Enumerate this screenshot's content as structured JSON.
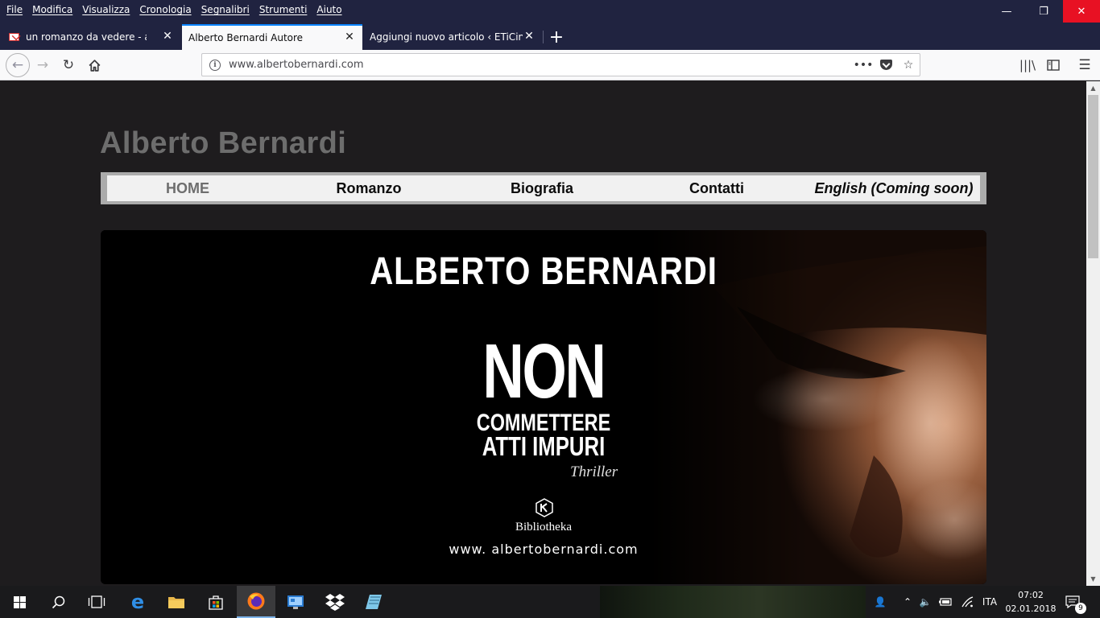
{
  "menu": {
    "items": [
      "File",
      "Modifica",
      "Visualizza",
      "Cronologia",
      "Segnalibri",
      "Strumenti",
      "Aiuto"
    ]
  },
  "window_controls": {
    "minimize": "—",
    "maximize": "❐",
    "close": "✕"
  },
  "tabs": [
    {
      "title": "un romanzo da vedere - associa",
      "icon": "gmail-icon",
      "active": false
    },
    {
      "title": "Alberto Bernardi Autore",
      "icon": "none",
      "active": true
    },
    {
      "title": "Aggiungi nuovo articolo ‹ ETiCinfo",
      "icon": "none",
      "active": false
    }
  ],
  "urlbar": {
    "url": "www.albertobernardi.com"
  },
  "site": {
    "title": "Alberto Bernardi",
    "nav": [
      "HOME",
      "Romanzo",
      "Biografia",
      "Contatti",
      "English (Coming soon)"
    ],
    "active_nav": "HOME",
    "banner": {
      "author": "ALBERTO BERNARDI",
      "title_big": "NON",
      "title_line1": "COMMETTERE",
      "title_line2": "ATTI IMPURI",
      "genre": "Thriller",
      "publisher": "Bibliotheka",
      "url": "www. albertobernardi.com"
    }
  },
  "taskbar": {
    "apps": [
      "start-icon",
      "search-icon",
      "task-view-icon",
      "edge-icon",
      "file-explorer-icon",
      "store-icon",
      "firefox-icon",
      "control-panel-icon",
      "dropbox-icon",
      "notepad-icon"
    ],
    "active_app": "firefox-icon",
    "language": "ITA",
    "time": "07:02",
    "date": "02.01.2018",
    "notifications": "9"
  },
  "colors": {
    "titlebar": "#202340",
    "active_tab_accent": "#0a84ff",
    "page_background": "#1e1c1e",
    "site_title": "#6d6d6d",
    "close_button": "#e81123"
  }
}
